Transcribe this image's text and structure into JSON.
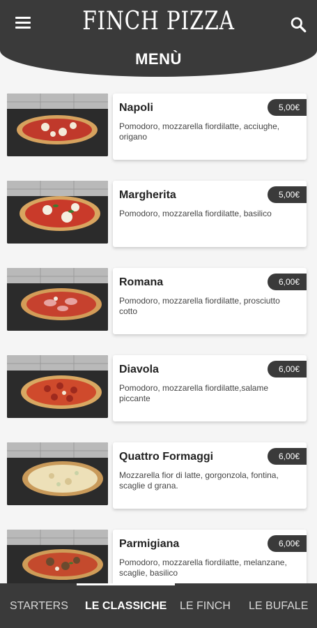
{
  "header": {
    "logo": "FINCH PIZZA",
    "title": "MENÙ",
    "menu_icon": "hamburger-menu-icon",
    "search_icon": "search-icon"
  },
  "colors": {
    "dark": "#3a3a3a",
    "background": "#f5f5f5",
    "card": "#ffffff"
  },
  "items": [
    {
      "name": "Napoli",
      "price": "5,00€",
      "description": "Pomodoro, mozzarella fiordilatte, acciughe, origano"
    },
    {
      "name": "Margherita",
      "price": "5,00€",
      "description": "Pomodoro, mozzarella fiordilatte, basilico"
    },
    {
      "name": "Romana",
      "price": "6,00€",
      "description": "Pomodoro, mozzarella fiordilatte, prosciutto cotto"
    },
    {
      "name": "Diavola",
      "price": "6,00€",
      "description": "Pomodoro, mozzarella fiordilatte,salame piccante"
    },
    {
      "name": "Quattro Formaggi",
      "price": "6,00€",
      "description": "Mozzarella fior di latte, gorgonzola, fontina, scaglie d grana."
    },
    {
      "name": "Parmigiana",
      "price": "6,00€",
      "description": "Pomodoro, mozzarella fiordilatte, melanzane, scaglie, basilico"
    }
  ],
  "tabs": [
    {
      "label": "STARTERS",
      "active": false
    },
    {
      "label": "LE CLASSICHE",
      "active": true
    },
    {
      "label": "LE FINCH",
      "active": false
    },
    {
      "label": "LE BUFALE",
      "active": false
    }
  ]
}
